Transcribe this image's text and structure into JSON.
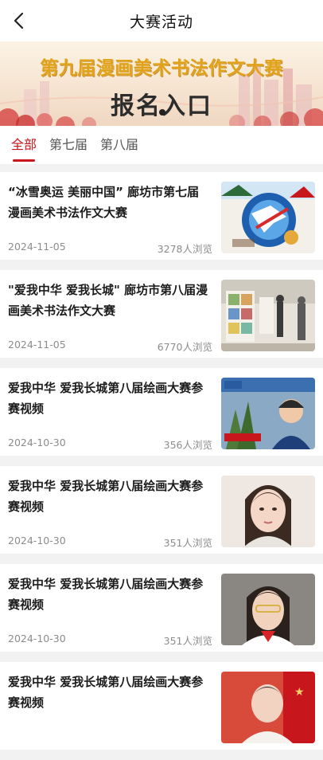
{
  "header": {
    "title": "大赛活动",
    "back_icon": "chevron-left-icon"
  },
  "banner": {
    "title": "第九届漫画美术书法作文大赛",
    "cta": "报名入口"
  },
  "tabs": [
    {
      "label": "全部",
      "active": true
    },
    {
      "label": "第七届",
      "active": false
    },
    {
      "label": "第八届",
      "active": false
    }
  ],
  "articles": [
    {
      "title": "“冰雪奥运 美丽中国” 廊坊市第七届漫画美术书法作文大赛",
      "date": "2024-11-05",
      "views": "3278人浏览"
    },
    {
      "title": "\"爱我中华 爱我长城\" 廊坊市第八届漫画美术书法作文大赛",
      "date": "2024-11-05",
      "views": "6770人浏览"
    },
    {
      "title": "爱我中华 爱我长城第八届绘画大赛参赛视频",
      "date": "2024-10-30",
      "views": "356人浏览"
    },
    {
      "title": "爱我中华 爱我长城第八届绘画大赛参赛视频",
      "date": "2024-10-30",
      "views": "351人浏览"
    },
    {
      "title": "爱我中华 爱我长城第八届绘画大赛参赛视频",
      "date": "2024-10-30",
      "views": "351人浏览"
    },
    {
      "title": "爱我中华 爱我长城第八届绘画大赛参赛视频",
      "date": "",
      "views": ""
    }
  ],
  "colors": {
    "accent": "#c8161d",
    "banner_gold": "#e0a21a"
  }
}
